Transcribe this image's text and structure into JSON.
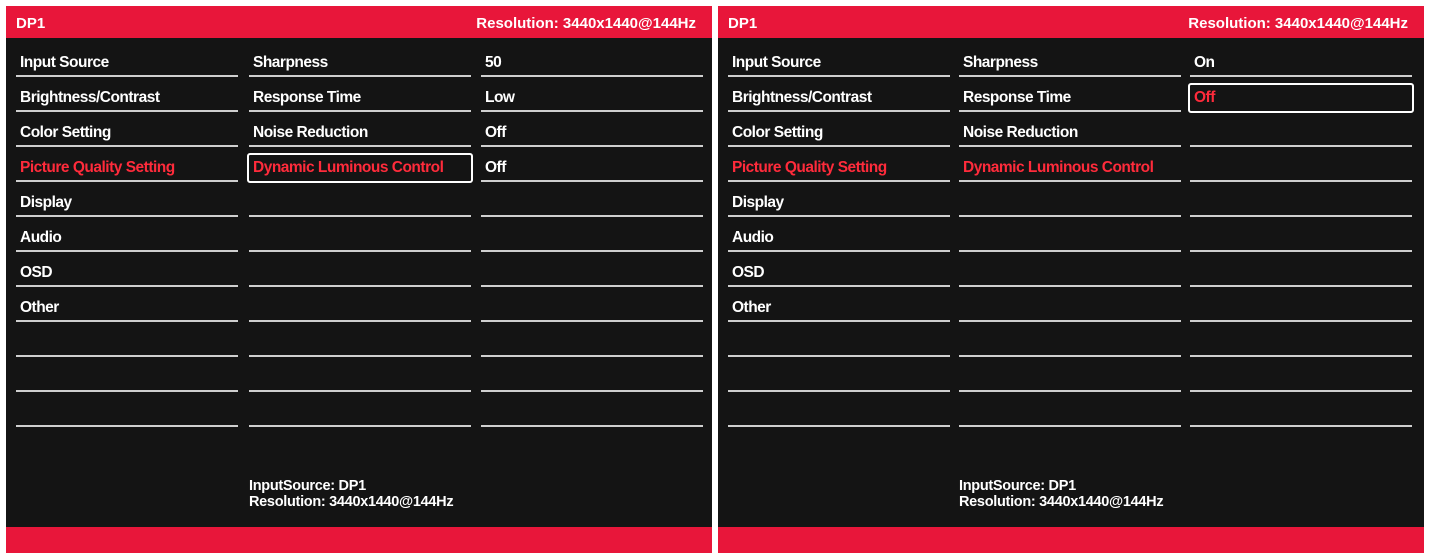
{
  "screens": [
    {
      "header": {
        "source": "DP1",
        "resolution": "Resolution:  3440x1440@144Hz"
      },
      "menu": [
        "Input Source",
        "Brightness/Contrast",
        "Color Setting",
        "Picture Quality Setting",
        "Display",
        "Audio",
        "OSD",
        "Other",
        "",
        "",
        ""
      ],
      "submenu": [
        "Sharpness",
        "Response Time",
        "Noise Reduction",
        "Dynamic Luminous Control",
        "",
        "",
        "",
        "",
        "",
        "",
        ""
      ],
      "values": [
        "50",
        "Low",
        "Off",
        "Off",
        "",
        "",
        "",
        "",
        "",
        "",
        ""
      ],
      "footer": {
        "input_source": "InputSource:  DP1",
        "resolution": "Resolution:  3440x1440@144Hz"
      }
    },
    {
      "header": {
        "source": "DP1",
        "resolution": "Resolution:  3440x1440@144Hz"
      },
      "menu": [
        "Input Source",
        "Brightness/Contrast",
        "Color Setting",
        "Picture Quality Setting",
        "Display",
        "Audio",
        "OSD",
        "Other",
        "",
        "",
        ""
      ],
      "submenu": [
        "Sharpness",
        "Response Time",
        "Noise Reduction",
        "Dynamic Luminous Control",
        "",
        "",
        "",
        "",
        "",
        "",
        ""
      ],
      "values": [
        "On",
        "Off",
        "",
        "",
        "",
        "",
        "",
        "",
        "",
        "",
        ""
      ],
      "footer": {
        "input_source": "InputSource:  DP1",
        "resolution": "Resolution:  3440x1440@144Hz"
      }
    }
  ],
  "colors": {
    "accent": "#e8163a",
    "highlight_text": "#ff2b3b",
    "background": "#141414",
    "text": "#ffffff"
  }
}
